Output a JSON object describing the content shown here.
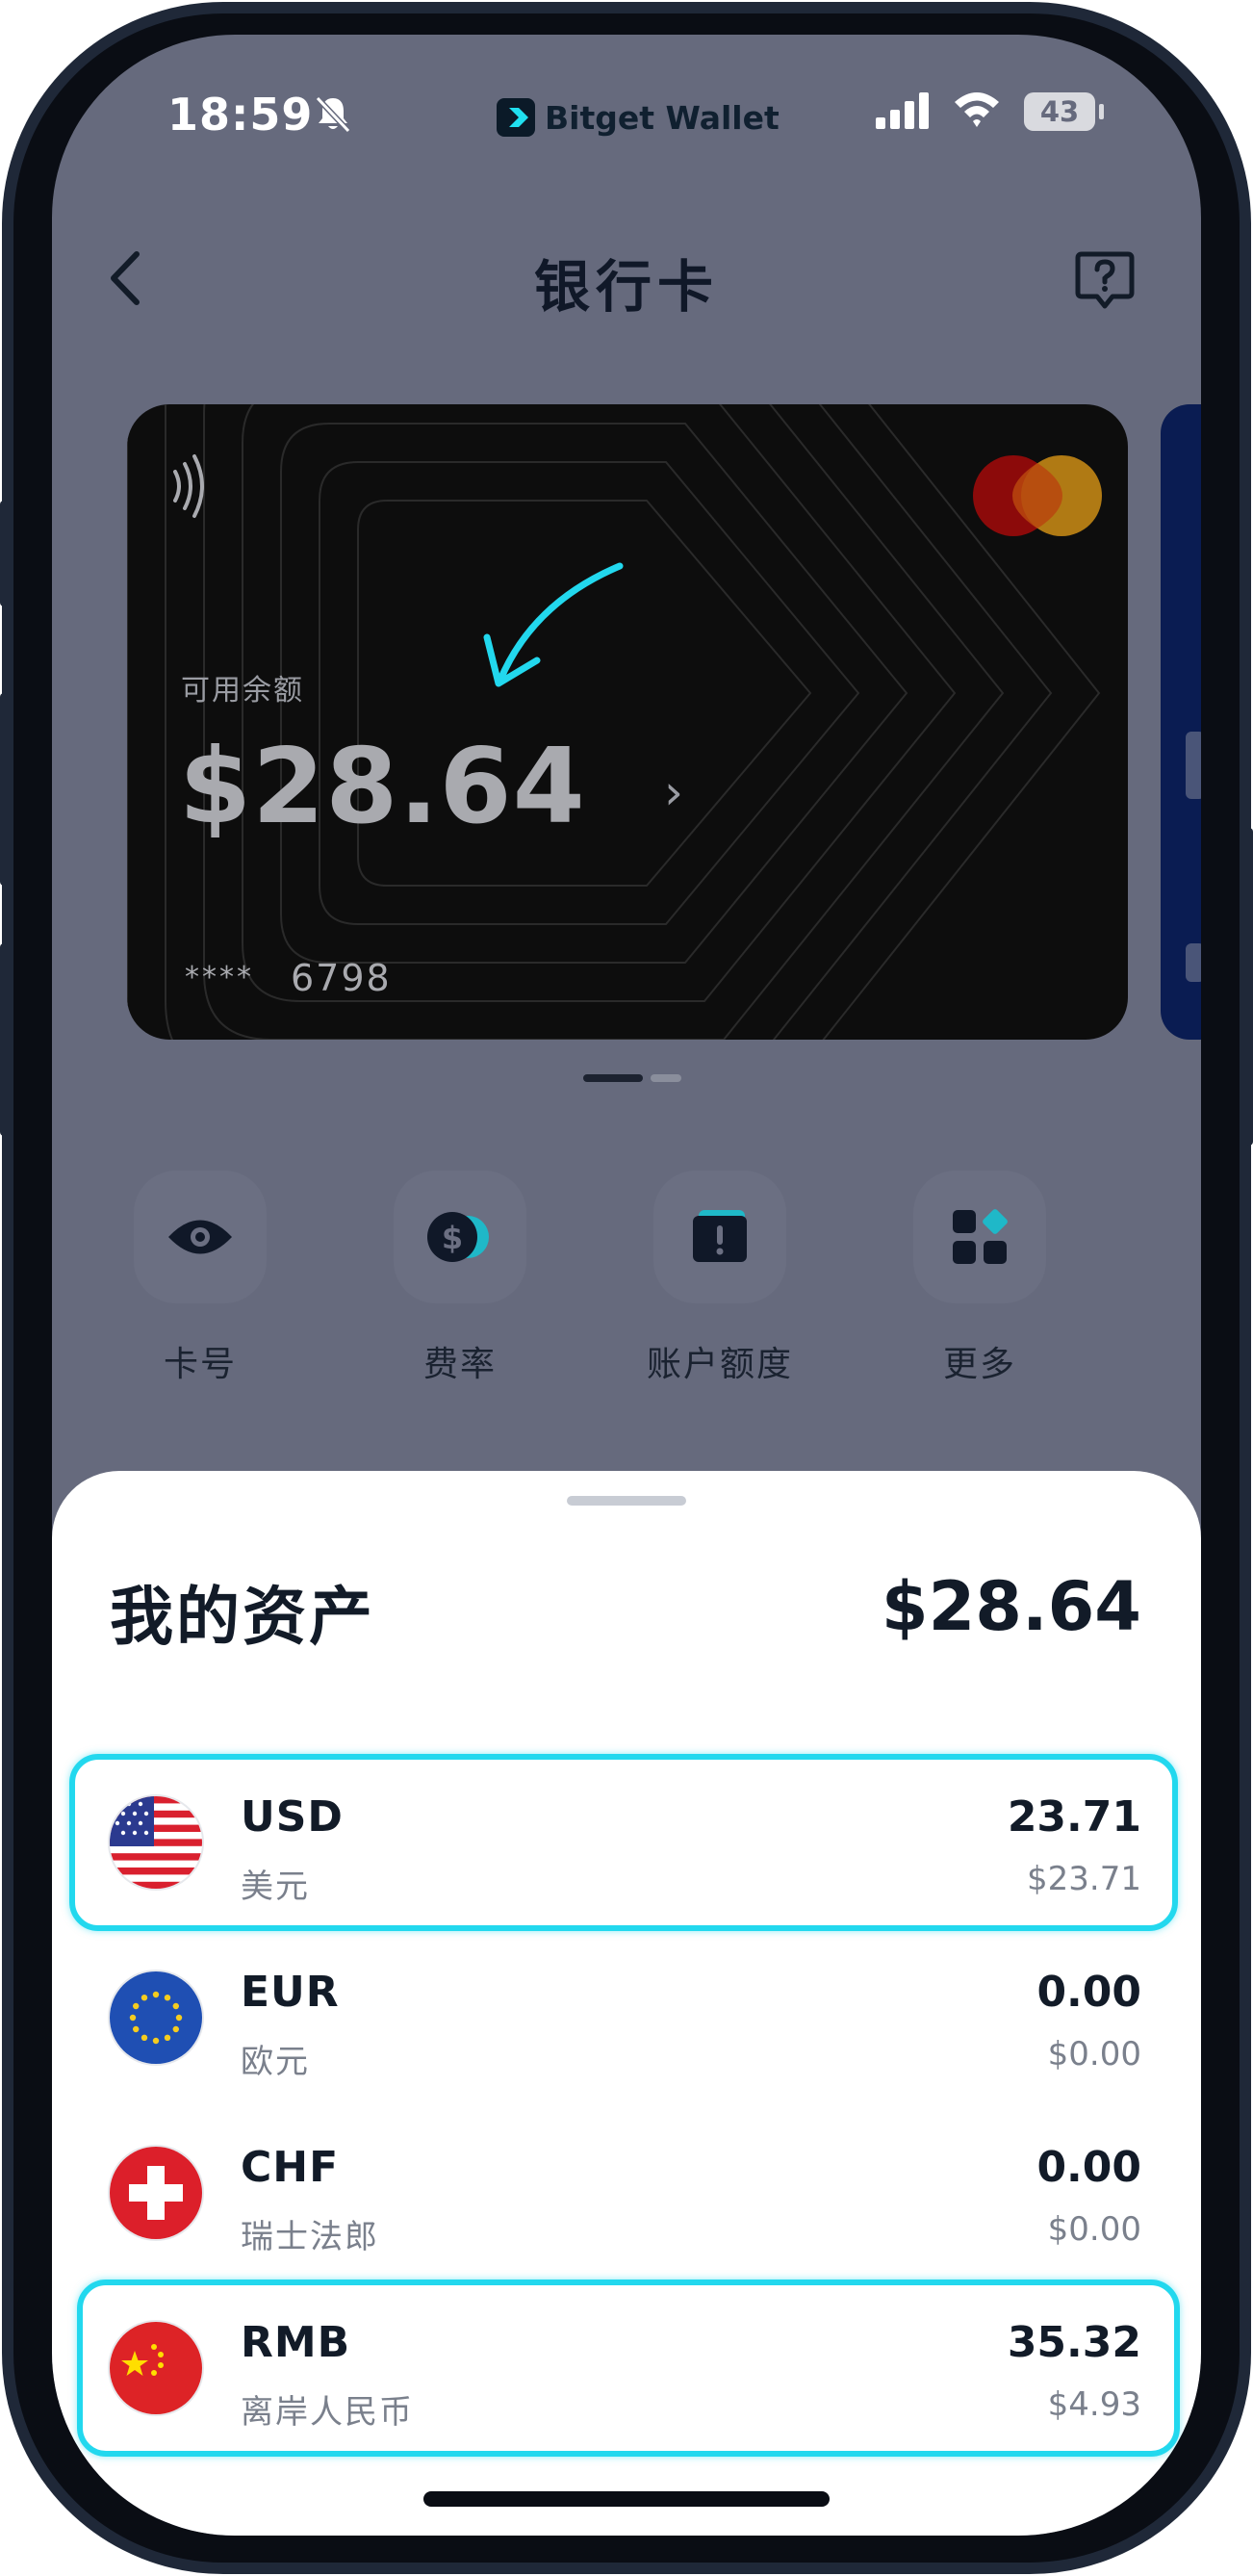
{
  "status_bar": {
    "time": "18:59",
    "brand": "Bitget Wallet",
    "battery": "43"
  },
  "header": {
    "title": "银行卡"
  },
  "card": {
    "balance_label": "可用余额",
    "balance": "$28.64",
    "mask": "****",
    "last4": "6798"
  },
  "actions": [
    {
      "label": "卡号",
      "icon": "eye-icon"
    },
    {
      "label": "费率",
      "icon": "dollar-coin-icon"
    },
    {
      "label": "账户额度",
      "icon": "alert-limit-icon"
    },
    {
      "label": "更多",
      "icon": "grid-more-icon"
    }
  ],
  "assets": {
    "title": "我的资产",
    "total": "$28.64",
    "items": [
      {
        "code": "USD",
        "name": "美元",
        "amount": "23.71",
        "usd_value": "$23.71",
        "flag": "us-flag-icon"
      },
      {
        "code": "EUR",
        "name": "欧元",
        "amount": "0.00",
        "usd_value": "$0.00",
        "flag": "eu-flag-icon"
      },
      {
        "code": "CHF",
        "name": "瑞士法郎",
        "amount": "0.00",
        "usd_value": "$0.00",
        "flag": "ch-flag-icon"
      },
      {
        "code": "RMB",
        "name": "离岸人民币",
        "amount": "35.32",
        "usd_value": "$4.93",
        "flag": "cn-flag-icon"
      }
    ]
  },
  "colors": {
    "accent": "#22d8ee",
    "overlay": "#666a7d",
    "card": "#0d0d0d",
    "text_primary": "#121b28",
    "text_secondary": "#7a808c"
  }
}
